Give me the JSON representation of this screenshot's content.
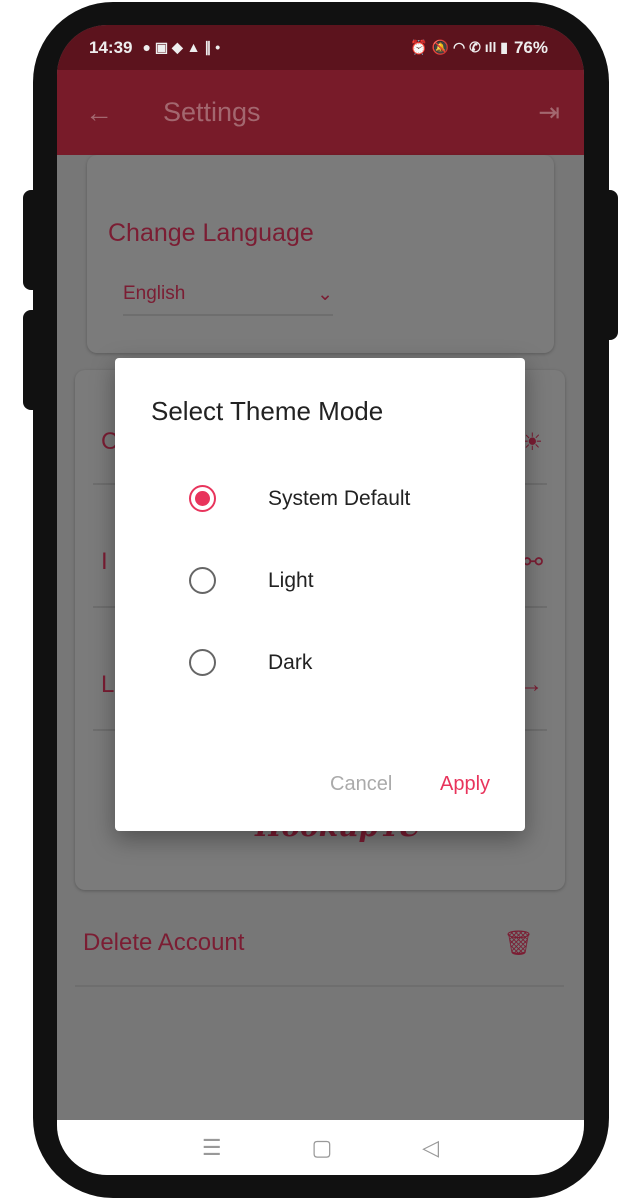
{
  "status_bar": {
    "time": "14:39",
    "battery": "76%",
    "left_icons": [
      "chat-icon",
      "linkedin-icon",
      "location-icon",
      "a-icon",
      "n-icon",
      "dot-icon"
    ],
    "right_icons": [
      "alarm-icon",
      "mute-icon",
      "wifi-icon",
      "wifi-call-icon",
      "signal-icon",
      "battery-icon"
    ]
  },
  "app_bar": {
    "title": "Settings",
    "back_icon": "arrow-left-icon",
    "logout_icon": "logout-icon"
  },
  "settings": {
    "language": {
      "label": "Change Language",
      "value": "English"
    },
    "rows": [
      {
        "label": "C",
        "icon": "theme-icon"
      },
      {
        "label": "I",
        "icon": "share-icon"
      },
      {
        "label": "L",
        "icon": "arrow-right-icon"
      }
    ],
    "logo": "Hookup4U",
    "delete": {
      "label": "Delete Account",
      "icon": "trash-icon"
    }
  },
  "dialog": {
    "title": "Select Theme Mode",
    "options": [
      {
        "label": "System Default",
        "selected": true
      },
      {
        "label": "Light",
        "selected": false
      },
      {
        "label": "Dark",
        "selected": false
      }
    ],
    "cancel": "Cancel",
    "apply": "Apply"
  },
  "nav_bar": {
    "recents": "☰",
    "home": "▢",
    "back": "◁"
  },
  "colors": {
    "accent": "#e8345c",
    "app_bar": "#781b29",
    "scrim": "#777777"
  }
}
